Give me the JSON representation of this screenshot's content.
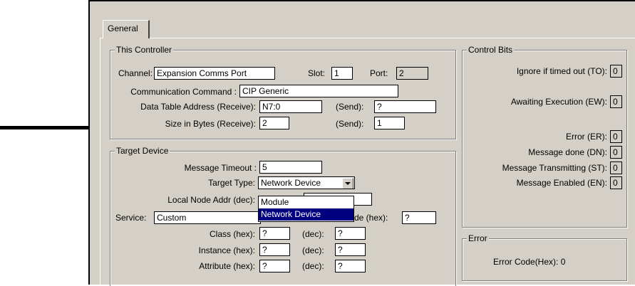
{
  "tab": {
    "general": "General"
  },
  "this_controller": {
    "title": "This Controller",
    "channel_label": "Channel:",
    "channel_value": "Expansion Comms Port",
    "slot_label": "Slot:",
    "slot_value": "1",
    "port_label": "Port:",
    "port_value": "2",
    "comm_cmd_label": "Communication Command :",
    "comm_cmd_value": "CIP Generic",
    "dta_receive_label": "Data Table Address (Receive):",
    "dta_receive_value": "N7:0",
    "dta_send_label": "(Send):",
    "dta_send_value": "?",
    "size_receive_label": "Size in Bytes (Receive):",
    "size_receive_value": "2",
    "size_send_label": "(Send):",
    "size_send_value": "1"
  },
  "target_device": {
    "title": "Target Device",
    "timeout_label": "Message Timeout :",
    "timeout_value": "5",
    "target_type_label": "Target Type:",
    "target_type_value": "Network Device",
    "local_node_label": "Local Node Addr (dec):",
    "service_label": "Service:",
    "service_value": "Custom",
    "service_code_label_partial": "de (hex):",
    "service_code_value": "?",
    "class_label": "Class (hex):",
    "class_hex": "?",
    "class_dec_label": "(dec):",
    "class_dec": "?",
    "instance_label": "Instance (hex):",
    "instance_hex": "?",
    "instance_dec_label": "(dec):",
    "instance_dec": "?",
    "attribute_label": "Attribute (hex):",
    "attribute_hex": "?",
    "attribute_dec_label": "(dec):",
    "attribute_dec": "?",
    "dropdown_options": [
      "Module",
      "Network Device"
    ],
    "dropdown_selected": "Network Device"
  },
  "control_bits": {
    "title": "Control Bits",
    "to_label": "Ignore if timed out (TO):",
    "to_value": "0",
    "ew_label": "Awaiting Execution (EW):",
    "ew_value": "0",
    "er_label": "Error (ER):",
    "er_value": "0",
    "dn_label": "Message done (DN):",
    "dn_value": "0",
    "st_label": "Message Transmitting (ST):",
    "st_value": "0",
    "en_label": "Message Enabled (EN):",
    "en_value": "0"
  },
  "error": {
    "title": "Error",
    "code_label": "Error Code(Hex): 0"
  },
  "colors": {
    "dialog_bg": "#d4d0c8",
    "selection": "#000080"
  }
}
